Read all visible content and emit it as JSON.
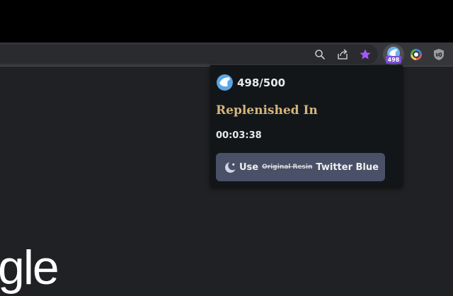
{
  "toolbar": {
    "icons": [
      "search-icon",
      "share-icon",
      "star-icon",
      "resin-extension-icon",
      "color-extension-icon",
      "ublock-icon"
    ],
    "bookmark_star_color": "#a259ff",
    "extension_badge": "498",
    "badge_color": "#7b4fd6"
  },
  "popup": {
    "resin_count": "498/500",
    "replenished_label": "Replenished In",
    "timer": "00:03:38",
    "button": {
      "use": "Use",
      "struck_text": "Original Resin",
      "replacement": "Twitter Blue"
    },
    "accent_color": "#d5b57c",
    "button_color": "#4a5068"
  },
  "page": {
    "logo_fragment": "gle"
  }
}
